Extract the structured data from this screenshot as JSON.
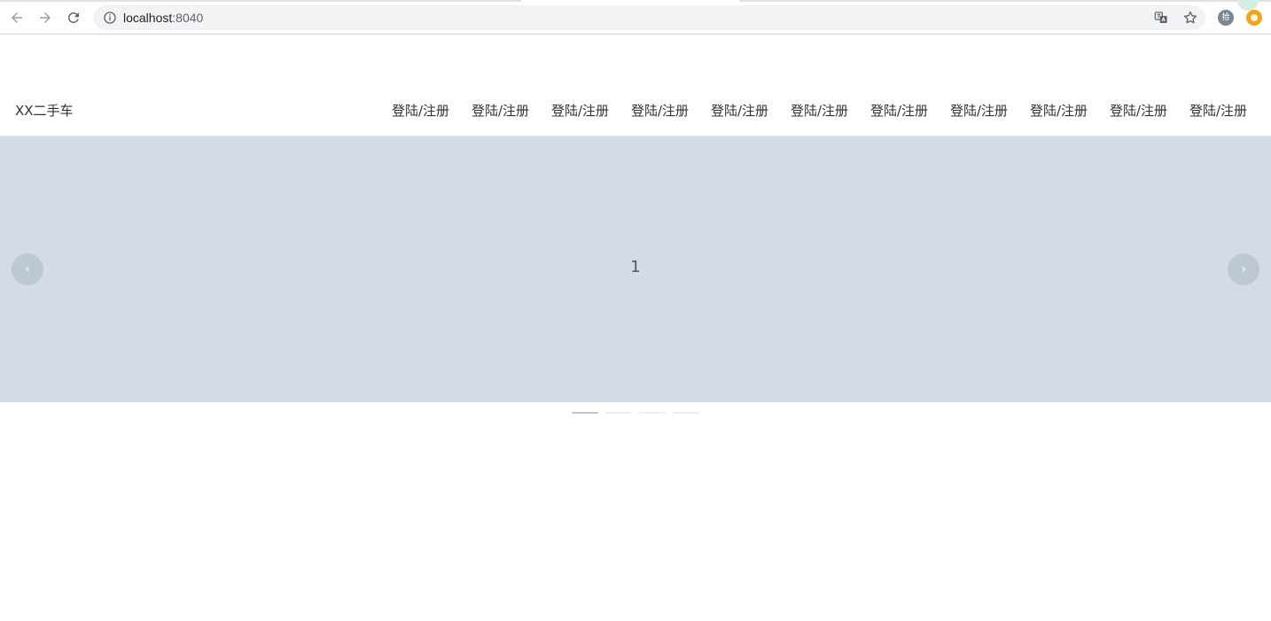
{
  "browser": {
    "url_host": "localhost",
    "url_port": ":8040",
    "extension_avatar_text": "拾",
    "icons": [
      "back-icon",
      "forward-icon",
      "reload-icon",
      "info-icon",
      "translate-icon",
      "star-icon"
    ]
  },
  "header": {
    "logo": "XX二手车",
    "nav": [
      "登陆/注册",
      "登陆/注册",
      "登陆/注册",
      "登陆/注册",
      "登陆/注册",
      "登陆/注册",
      "登陆/注册",
      "登陆/注册",
      "登陆/注册",
      "登陆/注册",
      "登陆/注册"
    ]
  },
  "carousel": {
    "current_slide_label": "1",
    "background_color": "#d3dce6",
    "slide_count": 4,
    "active_index": 0,
    "prev_arrow": "‹",
    "next_arrow": "›"
  }
}
